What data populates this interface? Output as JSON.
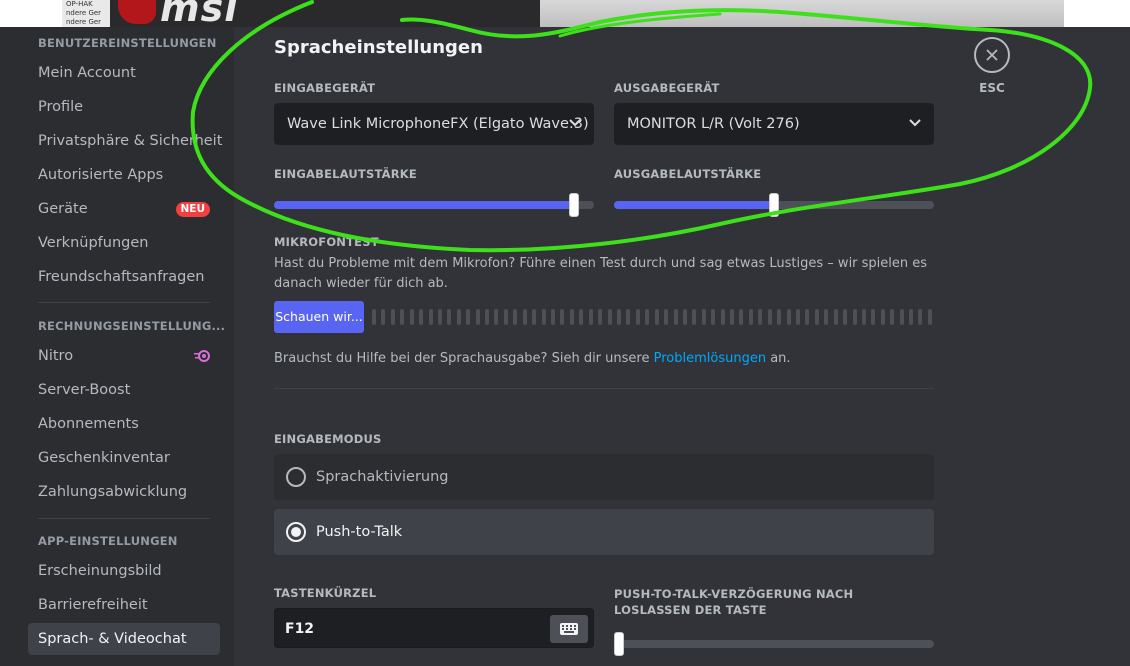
{
  "background": {
    "paper_lines": [
      "OP-HAK",
      "ndere Ger",
      "ndere Ger"
    ],
    "logo_text": "msi"
  },
  "sidebar": {
    "sections": [
      {
        "title": "BENUTZEREINSTELLUNGEN"
      },
      {
        "title": "RECHNUNGSEINSTELLUNG..."
      },
      {
        "title": "APP-EINSTELLUNGEN"
      }
    ],
    "user_items": [
      "Mein Account",
      "Profile",
      "Privatsphäre & Sicherheit",
      "Autorisierte Apps",
      "Geräte",
      "Verknüpfungen",
      "Freundschaftsanfragen"
    ],
    "billing_items": [
      "Nitro",
      "Server-Boost",
      "Abonnements",
      "Geschenkinventar",
      "Zahlungsabwicklung"
    ],
    "app_items": [
      "Erscheinungsbild",
      "Barrierefreiheit",
      "Sprach- & Videochat"
    ],
    "new_badge": "NEU",
    "active_item": "Sprach- & Videochat"
  },
  "main": {
    "title": "Spracheinstellungen",
    "input_device_label": "EINGABEGERÄT",
    "input_device_value": "Wave Link MicrophoneFX (Elgato Wave:3)",
    "output_device_label": "AUSGABEGERÄT",
    "output_device_value": "MONITOR L/R (Volt 276)",
    "input_volume_label": "EINGABELAUTSTÄRKE",
    "input_volume": 0.95,
    "output_volume_label": "AUSGABELAUTSTÄRKE",
    "output_volume": 0.5,
    "mic_test_label": "MIKROFONTEST",
    "mic_test_text": "Hast du Probleme mit dem Mikrofon? Führe einen Test durch und sag etwas Lustiges – wir spielen es danach wieder für dich ab.",
    "mic_test_button": "Schauen wir...",
    "help_text_before": "Brauchst du Hilfe bei der Sprachausgabe? Sieh dir unsere ",
    "help_link": "Problemlösungen",
    "help_text_after": " an.",
    "input_mode_label": "EINGABEMODUS",
    "input_modes": [
      "Sprachaktivierung",
      "Push-to-Talk"
    ],
    "selected_mode": "Push-to-Talk",
    "shortcut_label": "TASTENKÜRZEL",
    "shortcut_value": "F12",
    "ptt_delay_label": "PUSH-TO-TALK-VERZÖGERUNG NACH LOSLASSEN DER TASTE",
    "ptt_delay": 0.0,
    "esc_label": "ESC"
  },
  "colors": {
    "accent": "#5865f2",
    "sidebar_bg": "#2b2d31",
    "main_bg": "#313338",
    "annotation": "#3ee01b",
    "badge": "#f23f42",
    "link": "#00a8fc"
  }
}
